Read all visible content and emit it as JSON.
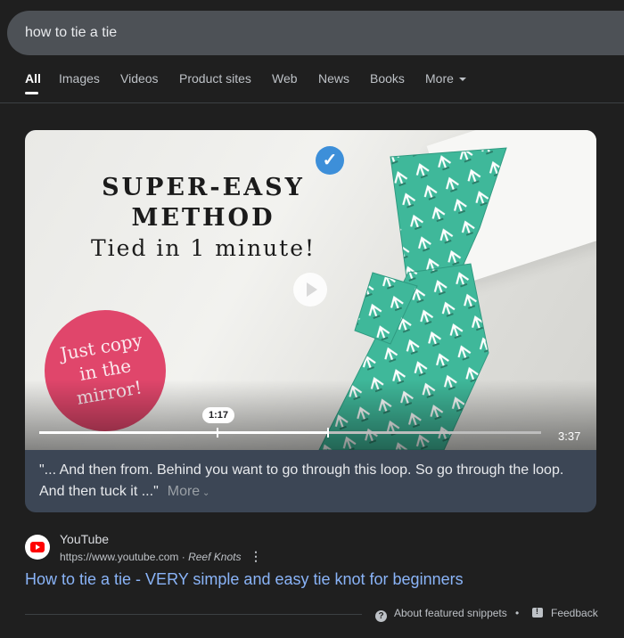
{
  "search": {
    "query": "how to tie a tie"
  },
  "tabs": [
    {
      "label": "All",
      "active": true
    },
    {
      "label": "Images"
    },
    {
      "label": "Videos"
    },
    {
      "label": "Product sites"
    },
    {
      "label": "Web"
    },
    {
      "label": "News"
    },
    {
      "label": "Books"
    },
    {
      "label": "More"
    }
  ],
  "video": {
    "headline_line1": "SUPER-EASY",
    "headline_line2": "METHOD",
    "headline_line3": "Tied in 1 minute!",
    "badge_text": "Just copy in the mirror!",
    "current_time": "1:17",
    "duration": "3:37",
    "progress_fraction": 0.355
  },
  "snippet": {
    "text": "\"... And then from. Behind you want to go through this loop. So go through the loop. And then tuck it ...\"",
    "more_label": "More"
  },
  "source": {
    "site_name": "YouTube",
    "url": "https://www.youtube.com",
    "breadcrumb": "Reef Knots",
    "separator": "·"
  },
  "result": {
    "title": "How to tie a tie - VERY simple and easy tie knot for beginners"
  },
  "footer": {
    "about_label": "About featured snippets",
    "separator": "•",
    "feedback_label": "Feedback"
  },
  "colors": {
    "background": "#1f1f1f",
    "link": "#8ab4f8",
    "snippet_bg": "#3c4655",
    "tie_green": "#3fb89a",
    "badge_pink": "#e0466b"
  }
}
